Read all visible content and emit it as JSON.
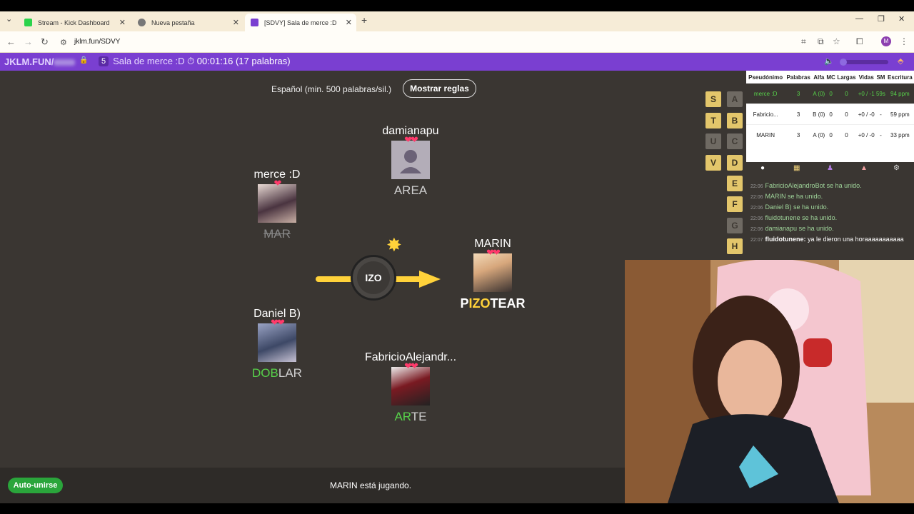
{
  "browser": {
    "tabs": [
      {
        "title": "Stream - Kick Dashboard"
      },
      {
        "title": "Nueva pestaña"
      },
      {
        "title": "[SDVY] Sala de merce :D"
      }
    ],
    "url": "jklm.fun/SDVY",
    "profile_initial": "M"
  },
  "gamebar": {
    "logo": "JKLM.FUN/",
    "room_count": "5",
    "room_name": "Sala de merce :D",
    "timer": "00:01:16 (17 palabras)"
  },
  "rules": {
    "text": "Español (min. 500 palabras/sil.)",
    "button": "Mostrar reglas"
  },
  "players": [
    {
      "name": "damianapu",
      "hearts": "❤❤",
      "word_green": "",
      "word_rest": "AREA"
    },
    {
      "name": "merce :D",
      "hearts": "❤",
      "word_green": "",
      "word_rest": "MAR"
    },
    {
      "name": "MARIN",
      "hearts": "❤❤",
      "word_green": "P",
      "word_yellow": "IZO",
      "word_rest": "TEAR"
    },
    {
      "name": "Daniel B)",
      "hearts": "❤❤",
      "word_green": "DOB",
      "word_rest": "LAR"
    },
    {
      "name": "FabricioAlejandr...",
      "hearts": "❤❤",
      "word_green": "AR",
      "word_rest": "TE"
    }
  ],
  "bomb": {
    "syllable": "IZO"
  },
  "letters": [
    {
      "letter": "S",
      "state": "on"
    },
    {
      "letter": "A",
      "state": "off"
    },
    {
      "letter": "T",
      "state": "on"
    },
    {
      "letter": "B",
      "state": "on"
    },
    {
      "letter": "U",
      "state": "off"
    },
    {
      "letter": "C",
      "state": "off"
    },
    {
      "letter": "V",
      "state": "on"
    },
    {
      "letter": "D",
      "state": "on"
    },
    {
      "letter": "E",
      "state": "on"
    },
    {
      "letter": "F",
      "state": "on"
    },
    {
      "letter": "G",
      "state": "off"
    },
    {
      "letter": "H",
      "state": "on"
    }
  ],
  "scoreboard": {
    "headers": [
      "Pseudónimo",
      "Palabras",
      "Alfa",
      "MC",
      "Largas",
      "Vidas",
      "SM",
      "Escritura"
    ],
    "rows": [
      [
        "merce :D",
        "3",
        "A (0)",
        "0",
        "0",
        "+0 / -1",
        "59s",
        "94 ppm"
      ],
      [
        "Fabricio...",
        "3",
        "B (0)",
        "0",
        "0",
        "+0 / -0",
        "-",
        "59 ppm"
      ],
      [
        "MARIN",
        "3",
        "A (0)",
        "0",
        "0",
        "+0 / -0",
        "-",
        "33 ppm"
      ]
    ]
  },
  "chat": [
    {
      "time": "22:06",
      "user": "",
      "text": "FabricioAlejandroBot se ha unido."
    },
    {
      "time": "22:06",
      "user": "",
      "text": "MARIN se ha unido."
    },
    {
      "time": "22:06",
      "user": "",
      "text": "Daniel B) se ha unido."
    },
    {
      "time": "22:06",
      "user": "",
      "text": "fluidotunene se ha unido."
    },
    {
      "time": "22:06",
      "user": "",
      "text": "damianapu se ha unido."
    },
    {
      "time": "22:07",
      "user": "fluidotunene:",
      "text": "ya le dieron una horaaaaaaaaaaa"
    }
  ],
  "status": "MARIN está jugando.",
  "auto_join": "Auto-unirse",
  "colors": {
    "accent": "#7a3fd1",
    "game_bg": "#3a3632",
    "green": "#57d24a",
    "yellow": "#ffd23a"
  }
}
